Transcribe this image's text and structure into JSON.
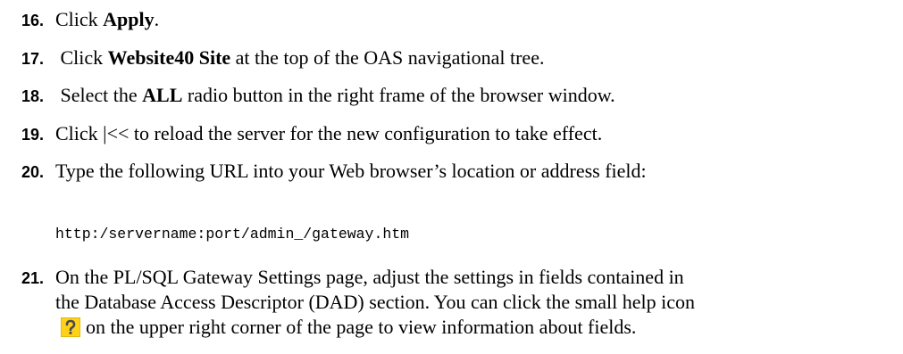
{
  "steps": [
    {
      "num": "16.",
      "pre": "Click ",
      "bold": "Apply",
      "post": "."
    },
    {
      "num": "17.",
      "pre": " Click ",
      "bold": "Website40 Site",
      "post": " at the top of the OAS navigational tree."
    },
    {
      "num": "18.",
      "pre": " Select the ",
      "bold": "ALL",
      "post": " radio button in the right frame of the browser window."
    },
    {
      "num": "19.",
      "text": "Click  |<< to reload the server for the new configuration to take effect."
    },
    {
      "num": "20.",
      "text": "Type the following URL into your Web browser’s location or address field:"
    },
    {
      "num": "21.",
      "text": "On the PL/SQL Gateway Settings page, adjust the settings in fields contained in"
    }
  ],
  "url_example": "http:/servername:port/admin_/gateway.htm",
  "step21_line2": "the Database Access Descriptor (DAD) section. You can click the small help icon",
  "step21_line3": "on the upper right corner of the page to view information about fields.",
  "icons": {
    "help": "help-icon"
  },
  "colors": {
    "help_icon_bg": "#ffd21a",
    "help_icon_fg": "#4a4a4a"
  }
}
